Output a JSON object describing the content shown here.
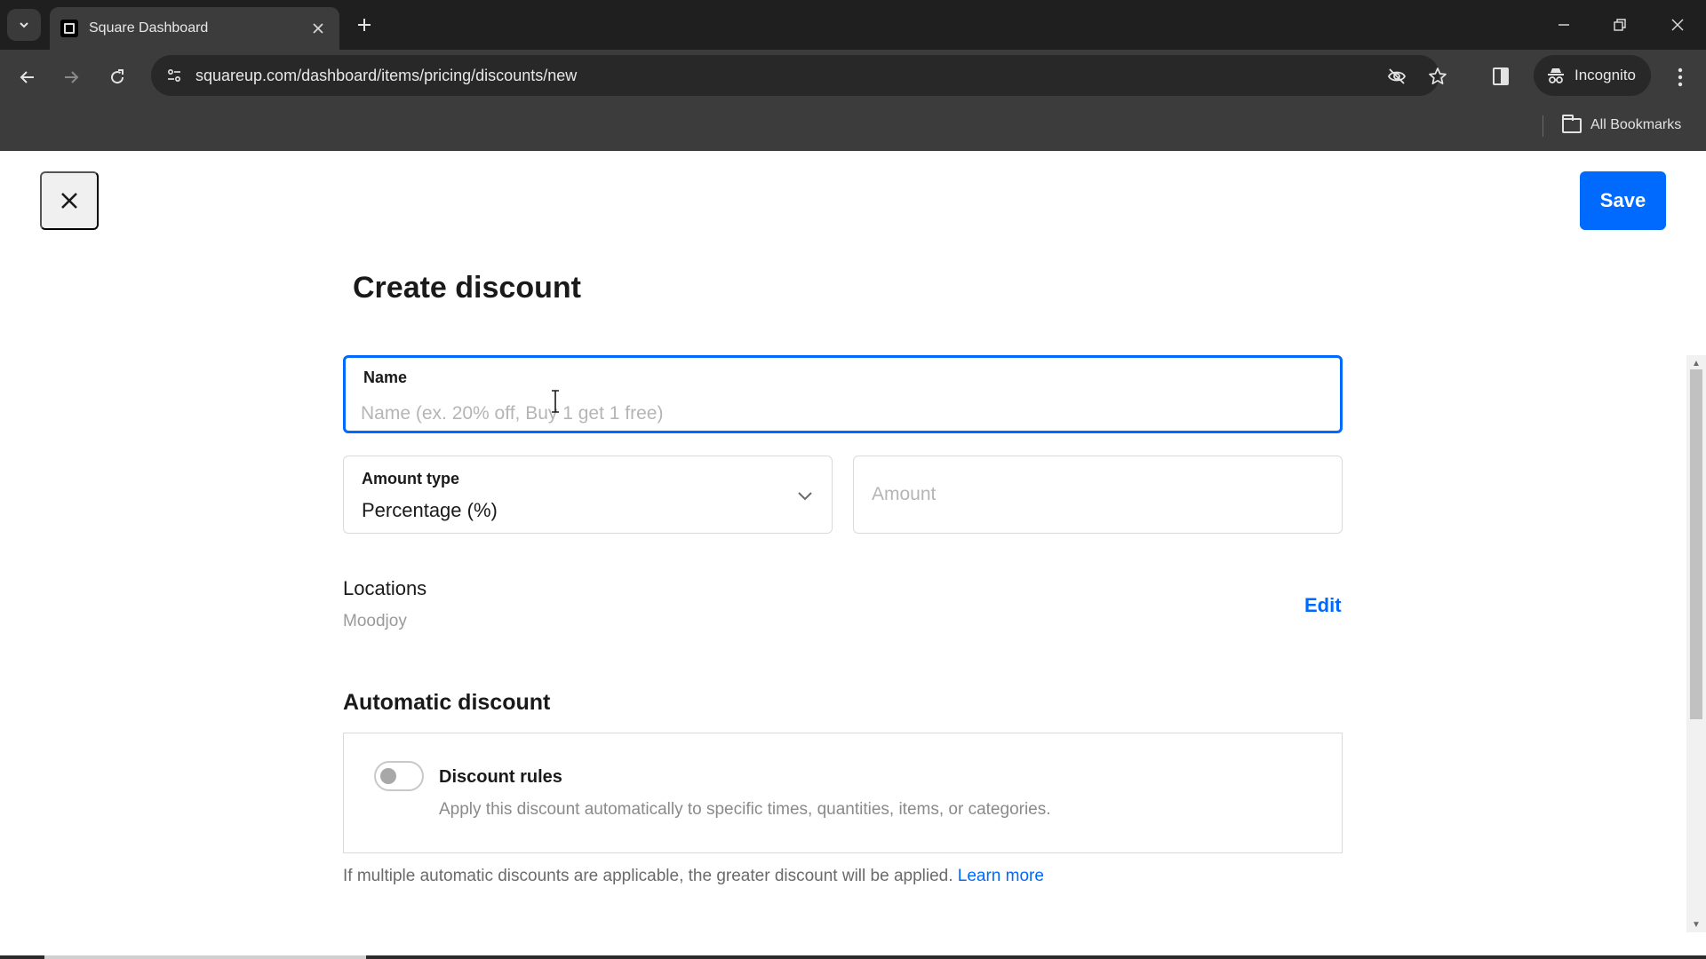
{
  "browser": {
    "tab_title": "Square Dashboard",
    "url": "squareup.com/dashboard/items/pricing/discounts/new",
    "incognito_label": "Incognito",
    "bookmarks_label": "All Bookmarks",
    "icons": {
      "tab_list": "chevron-down-icon",
      "tab_close": "close-icon",
      "new_tab": "plus-icon",
      "back": "arrow-left-icon",
      "forward": "arrow-right-icon",
      "reload": "reload-icon",
      "site_info": "tune-icon",
      "eye_off": "eye-off-icon",
      "bookmark": "star-icon",
      "side_panel": "side-panel-icon",
      "menu": "more-vert-icon",
      "minimize": "minimize-icon",
      "restore": "restore-icon",
      "close_window": "close-icon"
    }
  },
  "header": {
    "close_icon": "close-icon",
    "save_label": "Save"
  },
  "form": {
    "title": "Create discount",
    "name": {
      "label": "Name",
      "value": "",
      "placeholder": "Name (ex. 20% off, Buy 1 get 1 free)"
    },
    "amount_type": {
      "label": "Amount type",
      "selected": "Percentage (%)"
    },
    "amount": {
      "placeholder": "Amount",
      "value": ""
    },
    "locations": {
      "label": "Locations",
      "value": "Moodjoy",
      "edit_label": "Edit"
    },
    "automatic_discount": {
      "heading": "Automatic discount",
      "rules_title": "Discount rules",
      "rules_description": "Apply this discount automatically to specific times, quantities, items, or categories.",
      "rules_enabled": false,
      "footnote": "If multiple automatic discounts are applicable, the greater discount will be applied.",
      "learn_more_label": "Learn more"
    }
  },
  "colors": {
    "accent": "#006aff",
    "text": "#1a1a1a",
    "muted": "#9a9a9a"
  }
}
